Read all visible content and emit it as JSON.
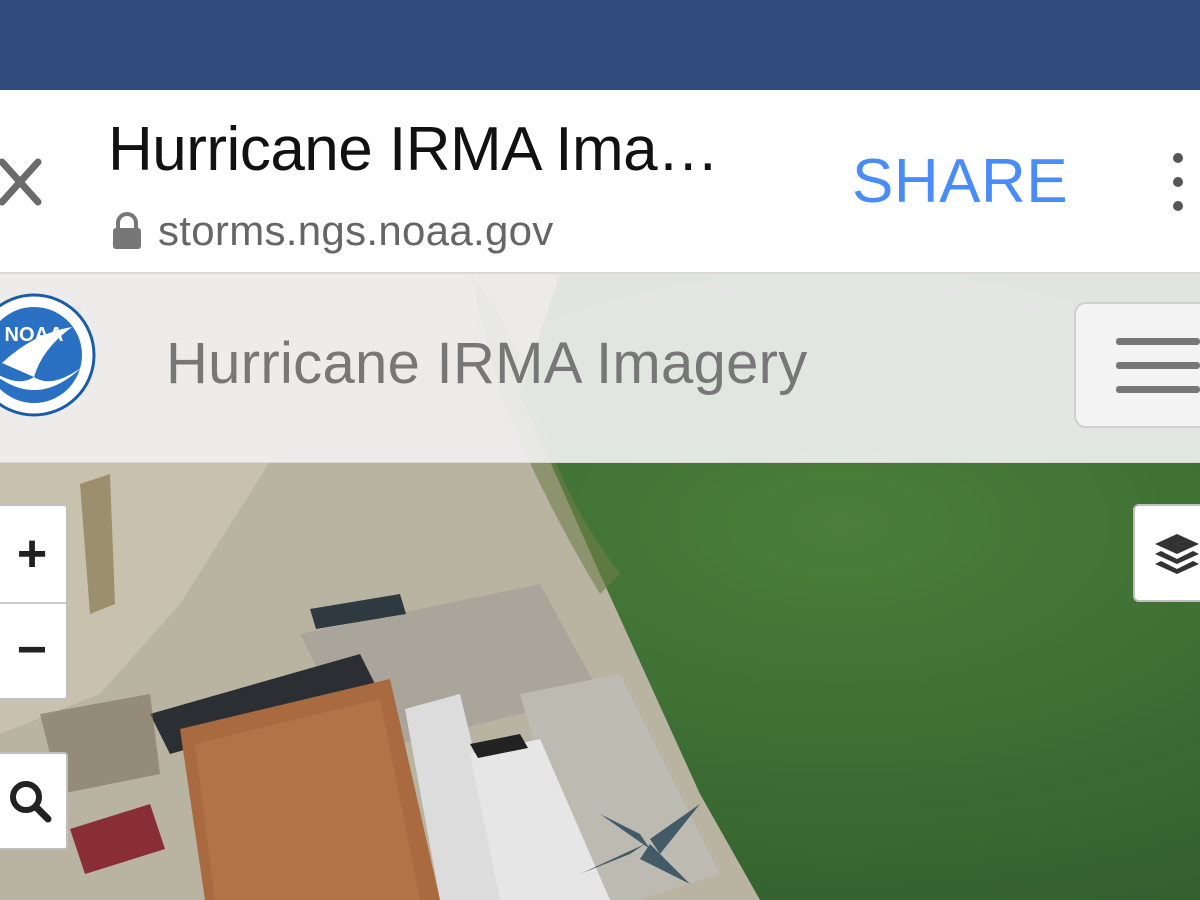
{
  "browser": {
    "page_title": "Hurricane IRMA Ima…",
    "url": "storms.ngs.noaa.gov",
    "share_label": "SHARE",
    "icons": {
      "close": "close-icon",
      "lock": "lock-icon",
      "more": "more-vert-icon"
    }
  },
  "site": {
    "title": "Hurricane IRMA Imagery",
    "logo": "noaa-logo",
    "logo_text": "NOAA",
    "menu_icon": "hamburger-menu-icon"
  },
  "map": {
    "controls": {
      "zoom_in_label": "+",
      "zoom_out_label": "−",
      "search_icon": "search-icon",
      "layers_icon": "layers-icon"
    }
  },
  "colors": {
    "status_bar": "#2f4a7b",
    "share_accent": "#4a8cf7",
    "water": "#3d6a35"
  }
}
